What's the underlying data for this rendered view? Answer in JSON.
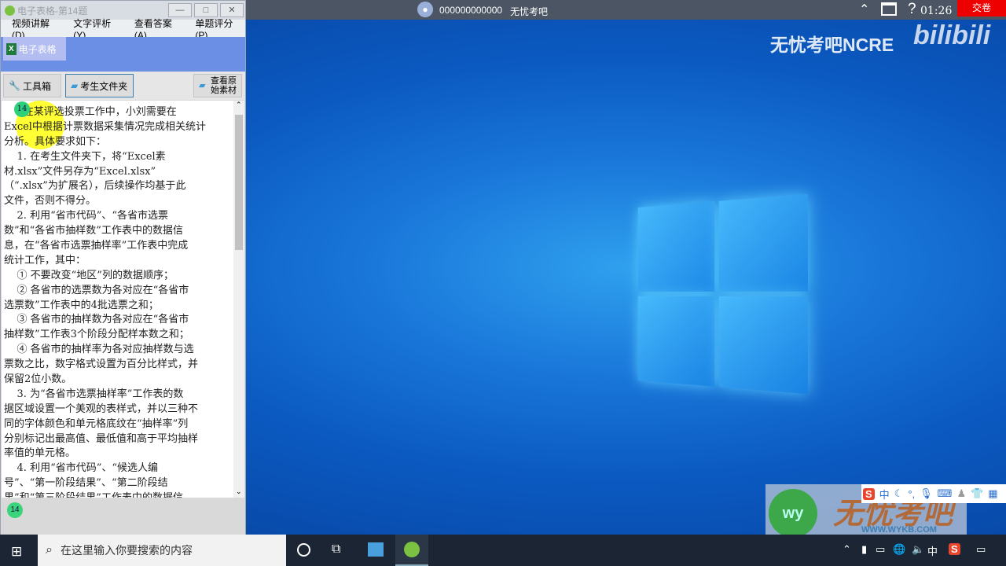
{
  "window": {
    "title": "电子表格-第14题",
    "minimize": "—",
    "maximize": "□",
    "close": "✕",
    "menu": [
      "视频讲解(D)",
      "文字评析(Y)",
      "查看答案(A)",
      "单题评分(P)"
    ],
    "tab": "电子表格",
    "toolbar": {
      "tools": "工具箱",
      "folder": "考生文件夹",
      "original": "查看原始素材"
    },
    "question_badge": "14",
    "footer_badge": "14",
    "lines": [
      "      在某评选投票工作中，小刘需要在",
      "Excel中根据计票数据采集情况完成相关统计",
      "分析。具体要求如下：",
      "    1. 在考生文件夹下，将“Excel素",
      "材.xlsx”文件另存为“Excel.xlsx”",
      "（“.xlsx”为扩展名），后续操作均基于此",
      "文件，否则不得分。",
      "    2. 利用“省市代码”、“各省市选票",
      "数”和“各省市抽样数”工作表中的数据信",
      "息，在“各省市选票抽样率”工作表中完成",
      "统计工作，其中：",
      "    ① 不要改变“地区”列的数据顺序；",
      "    ② 各省市的选票数为各对应在“各省市",
      "选票数”工作表中的4批选票之和；",
      "    ③ 各省市的抽样数为各对应在“各省市",
      "抽样数”工作表3个阶段分配样本数之和；",
      "    ④ 各省市的抽样率为各对应抽样数与选",
      "票数之比，数字格式设置为百分比样式，并",
      "保留2位小数。",
      "    3. 为“各省市选票抽样率”工作表的数",
      "据区域设置一个美观的表样式，并以三种不",
      "同的字体颜色和单元格底纹在“抽样率”列",
      "分别标记出最高值、最低值和高于平均抽样",
      "率值的单元格。",
      "    4. 利用“省市代码”、“候选人编",
      "号”、“第一阶段结果”、“第二阶段结",
      "果”和“第三阶段结果”工作表中的数据信"
    ]
  },
  "topbar": {
    "user": "000000000000",
    "site": "无忧考吧",
    "time": "01:26",
    "submit": "交卷"
  },
  "watermark": {
    "brand": "无忧考吧NCRE",
    "bili": "bilibili",
    "logo_text": "无忧考吧",
    "logo_url": "WWW.WYKB.COM",
    "logo_mark": "wy"
  },
  "ime": {
    "lang": "中"
  },
  "taskbar": {
    "search_placeholder": "在这里输入你要搜索的内容",
    "lang": "中"
  }
}
